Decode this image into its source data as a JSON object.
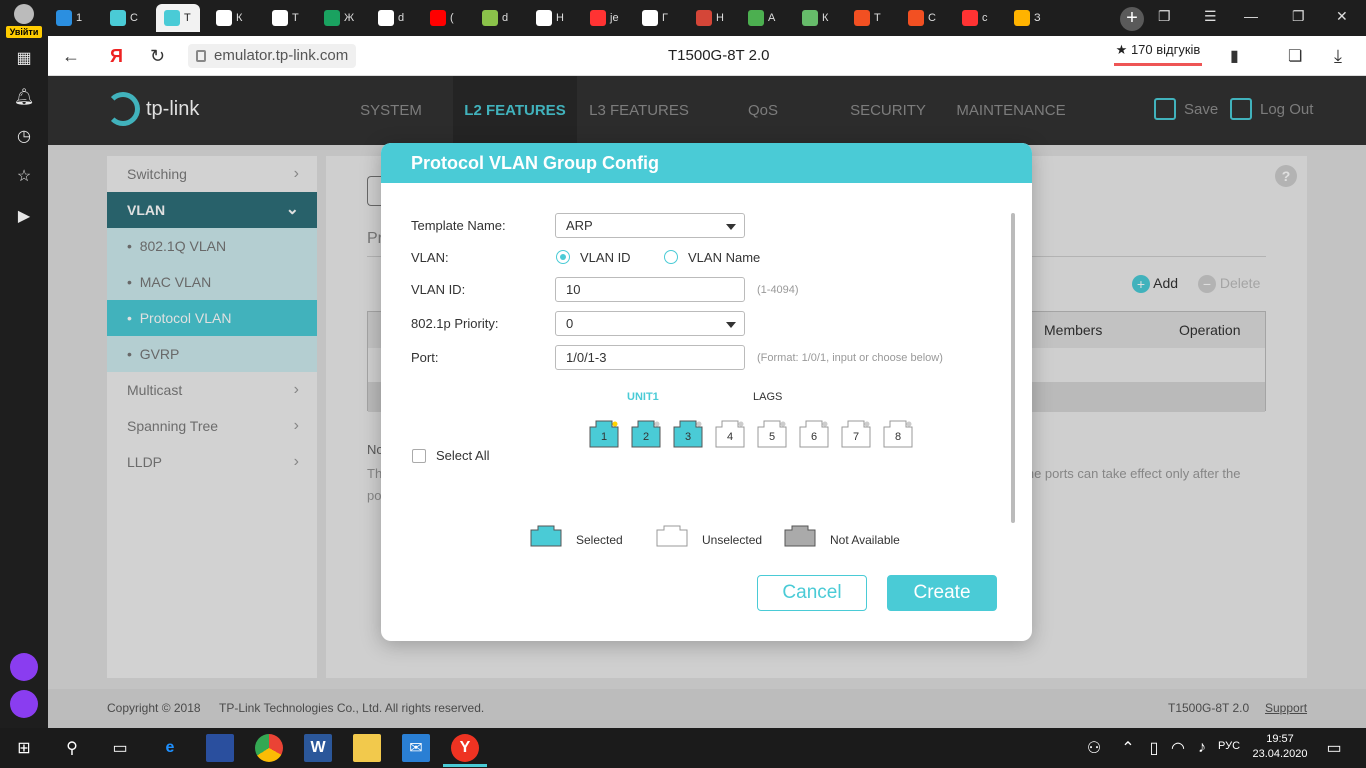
{
  "browser": {
    "login_label": "Увійти",
    "tabs": [
      {
        "label": "1",
        "color": "#2b8fe0"
      },
      {
        "label": "С",
        "color": "#4acbd6"
      },
      {
        "label": "Т",
        "color": "#4acbd6",
        "active": true
      },
      {
        "label": "К",
        "color": "#ffffff"
      },
      {
        "label": "Т",
        "color": "#ffffff"
      },
      {
        "label": "Ж",
        "color": "#1aa260"
      },
      {
        "label": "d",
        "color": "#ffffff"
      },
      {
        "label": "(",
        "color": "#ff0000"
      },
      {
        "label": "d",
        "color": "#8bc34a"
      },
      {
        "label": "Н",
        "color": "#ffffff"
      },
      {
        "label": "je",
        "color": "#ff3333"
      },
      {
        "label": "Г",
        "color": "#ffffff"
      },
      {
        "label": "Н",
        "color": "#d44638"
      },
      {
        "label": "А",
        "color": "#4caf50"
      },
      {
        "label": "К",
        "color": "#66bb6a"
      },
      {
        "label": "Т",
        "color": "#f25022"
      },
      {
        "label": "С",
        "color": "#f25022"
      },
      {
        "label": "с",
        "color": "#ff3333"
      },
      {
        "label": "З",
        "color": "#ffb300"
      }
    ],
    "url": "emulator.tp-link.com",
    "page_title": "T1500G-8T 2.0",
    "reviews": "170 відгуків",
    "reviews_star": "★"
  },
  "header": {
    "brand": "tp-link",
    "menu": [
      "SYSTEM",
      "L2 FEATURES",
      "L3 FEATURES",
      "QoS",
      "SECURITY",
      "MAINTENANCE"
    ],
    "active_menu": "L2 FEATURES",
    "save_label": "Save",
    "logout_label": "Log Out"
  },
  "sidebar": {
    "items": [
      {
        "label": "Switching",
        "type": "group-collapsed"
      },
      {
        "label": "VLAN",
        "type": "group-open"
      },
      {
        "label": "802.1Q VLAN",
        "type": "sub"
      },
      {
        "label": "MAC VLAN",
        "type": "sub"
      },
      {
        "label": "Protocol VLAN",
        "type": "sub-selected"
      },
      {
        "label": "GVRP",
        "type": "sub"
      },
      {
        "label": "Multicast",
        "type": "group-collapsed"
      },
      {
        "label": "Spanning Tree",
        "type": "group-collapsed"
      },
      {
        "label": "LLDP",
        "type": "group-collapsed"
      }
    ],
    "bullet": "•"
  },
  "content": {
    "tab_partial": "Pr",
    "add_label": "Add",
    "delete_label": "Delete",
    "col_members": "Members",
    "col_operation": "Operation",
    "note_prefix": "No",
    "note_line1_start": "Th",
    "note_line1_end": "f the ports can take effect only after the",
    "note_line2_start": "po",
    "help": "?"
  },
  "modal": {
    "title": "Protocol VLAN Group Config",
    "template_name_label": "Template Name:",
    "template_name_value": "ARP",
    "vlan_label": "VLAN:",
    "vlan_id_option": "VLAN ID",
    "vlan_name_option": "VLAN Name",
    "vlan_selected": "VLAN ID",
    "vlan_id_label": "VLAN ID:",
    "vlan_id_value": "10",
    "vlan_id_hint": "(1-4094)",
    "priority_label": "802.1p Priority:",
    "priority_value": "0",
    "port_label": "Port:",
    "port_value": "1/0/1-3",
    "port_hint": "(Format: 1/0/1, input or choose below)",
    "unit_label": "UNIT1",
    "lags_label": "LAGS",
    "select_all_label": "Select All",
    "ports": [
      {
        "num": "1",
        "state": "selected",
        "link": true
      },
      {
        "num": "2",
        "state": "selected",
        "link": false
      },
      {
        "num": "3",
        "state": "selected",
        "link": false
      },
      {
        "num": "4",
        "state": "unselected",
        "link": false
      },
      {
        "num": "5",
        "state": "unselected",
        "link": false
      },
      {
        "num": "6",
        "state": "unselected",
        "link": false
      },
      {
        "num": "7",
        "state": "unselected",
        "link": false
      },
      {
        "num": "8",
        "state": "unselected",
        "link": false
      }
    ],
    "legend_selected": "Selected",
    "legend_unselected": "Unselected",
    "legend_not_available": "Not Available",
    "cancel_label": "Cancel",
    "create_label": "Create"
  },
  "footer": {
    "copyright": "Copyright © 2018",
    "company": "TP-Link Technologies Co., Ltd. All rights reserved.",
    "model": "T1500G-8T 2.0",
    "support": "Support"
  },
  "taskbar": {
    "lang": "РУС",
    "time": "19:57",
    "date": "23.04.2020"
  },
  "colors": {
    "accent": "#4acbd6",
    "header_bg": "#333333",
    "vlan_group_bg": "#2e6f79",
    "not_available": "#aaaaaa"
  }
}
